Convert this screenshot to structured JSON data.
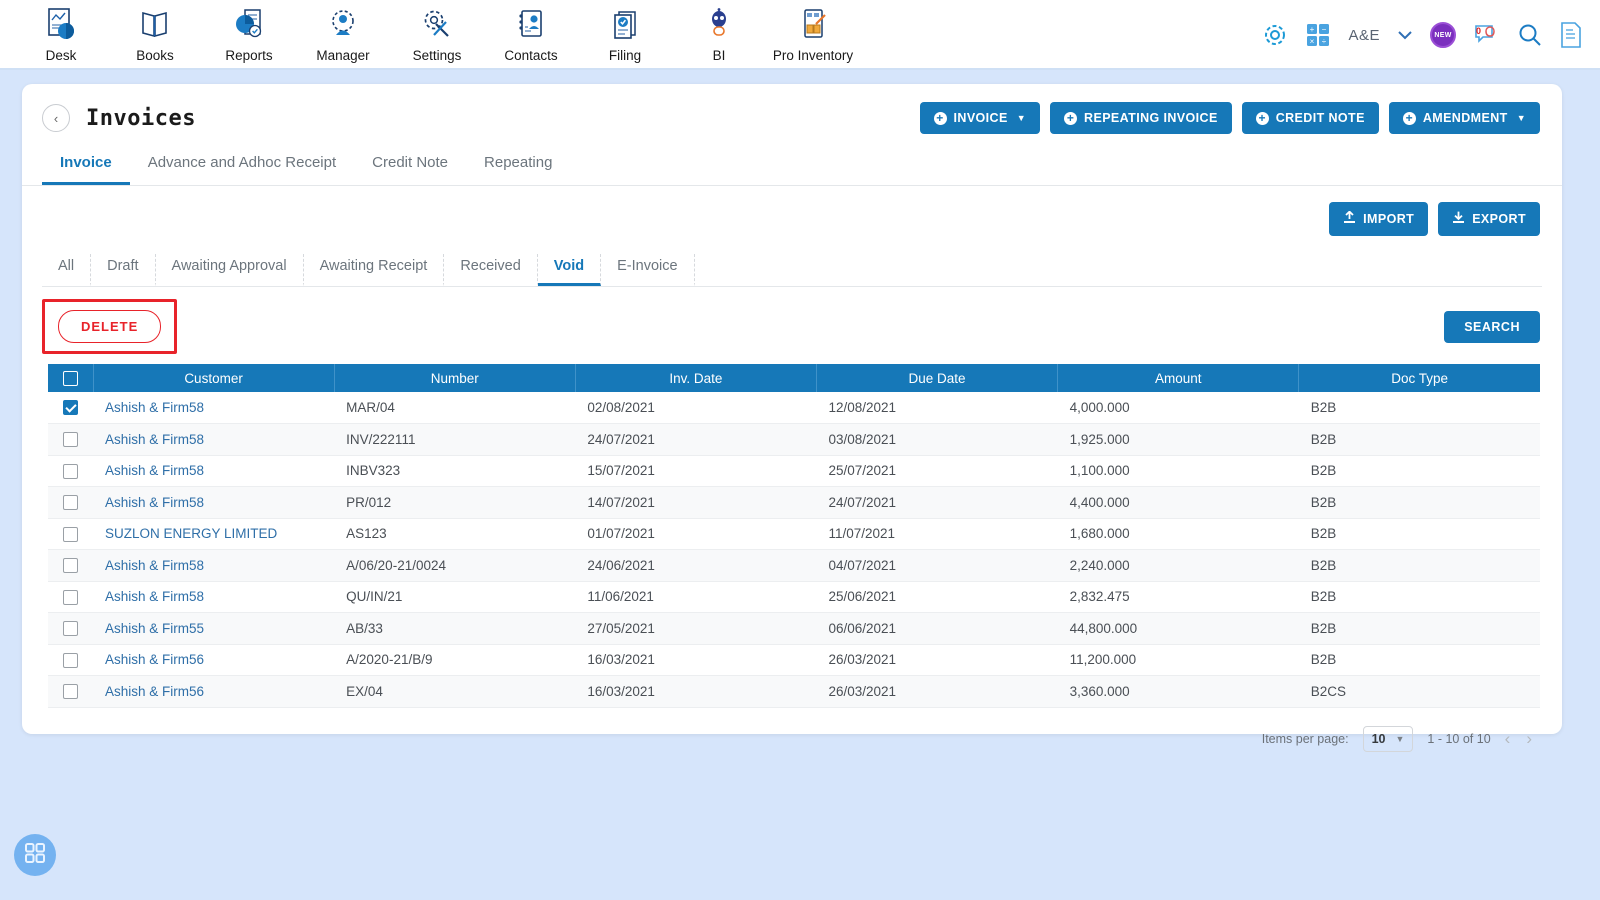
{
  "topnav": {
    "apps": [
      {
        "label": "Desk",
        "icon": "desk-chart-icon"
      },
      {
        "label": "Books",
        "icon": "books-icon"
      },
      {
        "label": "Reports",
        "icon": "reports-piechart-icon"
      },
      {
        "label": "Manager",
        "icon": "manager-gear-person-icon"
      },
      {
        "label": "Settings",
        "icon": "settings-tools-icon"
      },
      {
        "label": "Contacts",
        "icon": "contacts-card-icon"
      },
      {
        "label": "Filing",
        "icon": "filing-document-icon"
      },
      {
        "label": "BI",
        "icon": "bi-robot-icon"
      },
      {
        "label": "Pro Inventory",
        "icon": "pro-inventory-boxes-icon"
      }
    ],
    "right": {
      "gear": "gear-icon",
      "calculator": "calculator-icon",
      "org_name": "A&E",
      "org_caret": "⌄",
      "new_badge": "NEW",
      "notification_count": "0",
      "search": "search-icon",
      "document": "document-icon"
    }
  },
  "page": {
    "back": "‹",
    "title": "Invoices",
    "action_buttons": [
      {
        "label": "INVOICE",
        "caret": true
      },
      {
        "label": "REPEATING INVOICE",
        "caret": false
      },
      {
        "label": "CREDIT NOTE",
        "caret": false
      },
      {
        "label": "AMENDMENT",
        "caret": true
      }
    ],
    "tabs": [
      {
        "label": "Invoice",
        "active": true
      },
      {
        "label": "Advance and Adhoc Receipt",
        "active": false
      },
      {
        "label": "Credit Note",
        "active": false
      },
      {
        "label": "Repeating",
        "active": false
      }
    ],
    "import_label": "IMPORT",
    "export_label": "EXPORT",
    "status_tabs": [
      {
        "label": "All",
        "active": false
      },
      {
        "label": "Draft",
        "active": false
      },
      {
        "label": "Awaiting Approval",
        "active": false
      },
      {
        "label": "Awaiting Receipt",
        "active": false
      },
      {
        "label": "Received",
        "active": false
      },
      {
        "label": "Void",
        "active": true
      },
      {
        "label": "E-Invoice",
        "active": false
      }
    ],
    "delete_label": "DELETE",
    "search_label": "SEARCH"
  },
  "table": {
    "columns": [
      "Customer",
      "Number",
      "Inv. Date",
      "Due Date",
      "Amount",
      "Doc Type"
    ],
    "rows": [
      {
        "checked": true,
        "customer": "Ashish & Firm58",
        "number": "MAR/04",
        "inv_date": "02/08/2021",
        "due_date": "12/08/2021",
        "amount": "4,000.000",
        "doc_type": "B2B"
      },
      {
        "checked": false,
        "customer": "Ashish & Firm58",
        "number": "INV/222111",
        "inv_date": "24/07/2021",
        "due_date": "03/08/2021",
        "amount": "1,925.000",
        "doc_type": "B2B"
      },
      {
        "checked": false,
        "customer": "Ashish & Firm58",
        "number": "INBV323",
        "inv_date": "15/07/2021",
        "due_date": "25/07/2021",
        "amount": "1,100.000",
        "doc_type": "B2B"
      },
      {
        "checked": false,
        "customer": "Ashish & Firm58",
        "number": "PR/012",
        "inv_date": "14/07/2021",
        "due_date": "24/07/2021",
        "amount": "4,400.000",
        "doc_type": "B2B"
      },
      {
        "checked": false,
        "customer": "SUZLON ENERGY LIMITED",
        "number": "AS123",
        "inv_date": "01/07/2021",
        "due_date": "11/07/2021",
        "amount": "1,680.000",
        "doc_type": "B2B"
      },
      {
        "checked": false,
        "customer": "Ashish & Firm58",
        "number": "A/06/20-21/0024",
        "inv_date": "24/06/2021",
        "due_date": "04/07/2021",
        "amount": "2,240.000",
        "doc_type": "B2B"
      },
      {
        "checked": false,
        "customer": "Ashish & Firm58",
        "number": "QU/IN/21",
        "inv_date": "11/06/2021",
        "due_date": "25/06/2021",
        "amount": "2,832.475",
        "doc_type": "B2B"
      },
      {
        "checked": false,
        "customer": "Ashish & Firm55",
        "number": "AB/33",
        "inv_date": "27/05/2021",
        "due_date": "06/06/2021",
        "amount": "44,800.000",
        "doc_type": "B2B"
      },
      {
        "checked": false,
        "customer": "Ashish & Firm56",
        "number": "A/2020-21/B/9",
        "inv_date": "16/03/2021",
        "due_date": "26/03/2021",
        "amount": "11,200.000",
        "doc_type": "B2B"
      },
      {
        "checked": false,
        "customer": "Ashish & Firm56",
        "number": "EX/04",
        "inv_date": "16/03/2021",
        "due_date": "26/03/2021",
        "amount": "3,360.000",
        "doc_type": "B2CS"
      }
    ]
  },
  "paginator": {
    "items_per_page_label": "Items per page:",
    "items_per_page_value": "10",
    "range_label": "1 - 10 of 10",
    "prev": "‹",
    "next": "›"
  },
  "fab": {
    "icon": "grid-apps-icon"
  },
  "colors": {
    "accent": "#1678b8",
    "danger": "#e8232a",
    "link": "#2f6fa8",
    "page_bg": "#d6e5fb",
    "badge_purple": "#7b2fbe"
  }
}
